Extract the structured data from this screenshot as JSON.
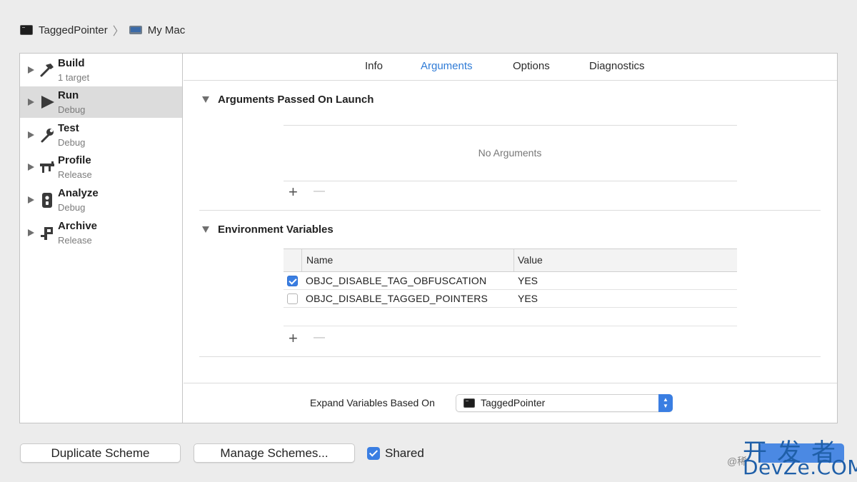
{
  "breadcrumb": {
    "target": "TaggedPointer",
    "separator": "〉",
    "destination": "My Mac"
  },
  "sidebar": {
    "items": [
      {
        "title": "Build",
        "subtitle": "1 target",
        "icon": "hammer-icon",
        "selected": false
      },
      {
        "title": "Run",
        "subtitle": "Debug",
        "icon": "play-icon",
        "selected": true
      },
      {
        "title": "Test",
        "subtitle": "Debug",
        "icon": "wrench-icon",
        "selected": false
      },
      {
        "title": "Profile",
        "subtitle": "Release",
        "icon": "profile-icon",
        "selected": false
      },
      {
        "title": "Analyze",
        "subtitle": "Debug",
        "icon": "analyze-icon",
        "selected": false
      },
      {
        "title": "Archive",
        "subtitle": "Release",
        "icon": "archive-icon",
        "selected": false
      }
    ]
  },
  "tabs": [
    {
      "label": "Info",
      "active": false
    },
    {
      "label": "Arguments",
      "active": true
    },
    {
      "label": "Options",
      "active": false
    },
    {
      "label": "Diagnostics",
      "active": false
    }
  ],
  "arguments": {
    "header": "Arguments Passed On Launch",
    "empty_text": "No Arguments",
    "add": "+",
    "remove": "—"
  },
  "environment": {
    "header": "Environment Variables",
    "columns": {
      "name": "Name",
      "value": "Value"
    },
    "rows": [
      {
        "enabled": true,
        "name": "OBJC_DISABLE_TAG_OBFUSCATION",
        "value": "YES"
      },
      {
        "enabled": false,
        "name": "OBJC_DISABLE_TAGGED_POINTERS",
        "value": "YES"
      }
    ],
    "add": "+",
    "remove": "—"
  },
  "footer": {
    "expand_label": "Expand Variables Based On",
    "expand_value": "TaggedPointer"
  },
  "buttons": {
    "duplicate": "Duplicate Scheme",
    "manage": "Manage Schemes...",
    "shared_label": "Shared",
    "shared_checked": true
  },
  "watermark": {
    "cn": "开发者",
    "en": "DevZe.COM",
    "small": "@稀"
  },
  "colors": {
    "accent": "#3a7ee2",
    "active_tab": "#2f7bd6",
    "selected_row": "#dcdcdc",
    "background": "#ececec"
  }
}
